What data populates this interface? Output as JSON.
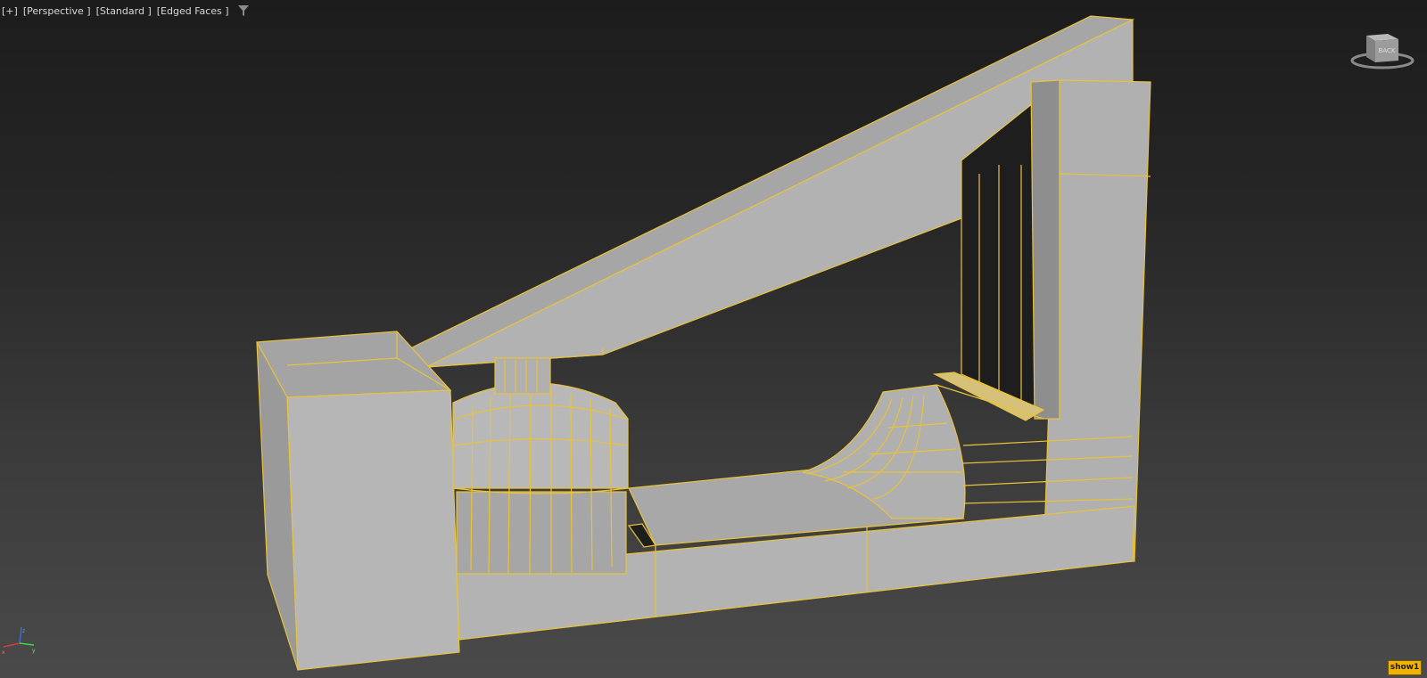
{
  "viewport_menu": {
    "plus": "[+]",
    "view": "[Perspective ]",
    "shading": "[Standard ]",
    "display": "[Edged Faces ]",
    "filter_icon": "filter-funnel-icon"
  },
  "viewcube": {
    "face_label": "BACK"
  },
  "axis": {
    "x": "x",
    "y": "y",
    "z": "z"
  },
  "badge": {
    "label": "show1"
  },
  "colors": {
    "background_top": "#1c1c1c",
    "background_bottom": "#4a4a4a",
    "wire_edges": "#e8c23a",
    "face_light": "#b4b4b4",
    "face_mid": "#9a9a9a",
    "face_dark": "#1e1e1e",
    "badge": "#f0b400"
  }
}
